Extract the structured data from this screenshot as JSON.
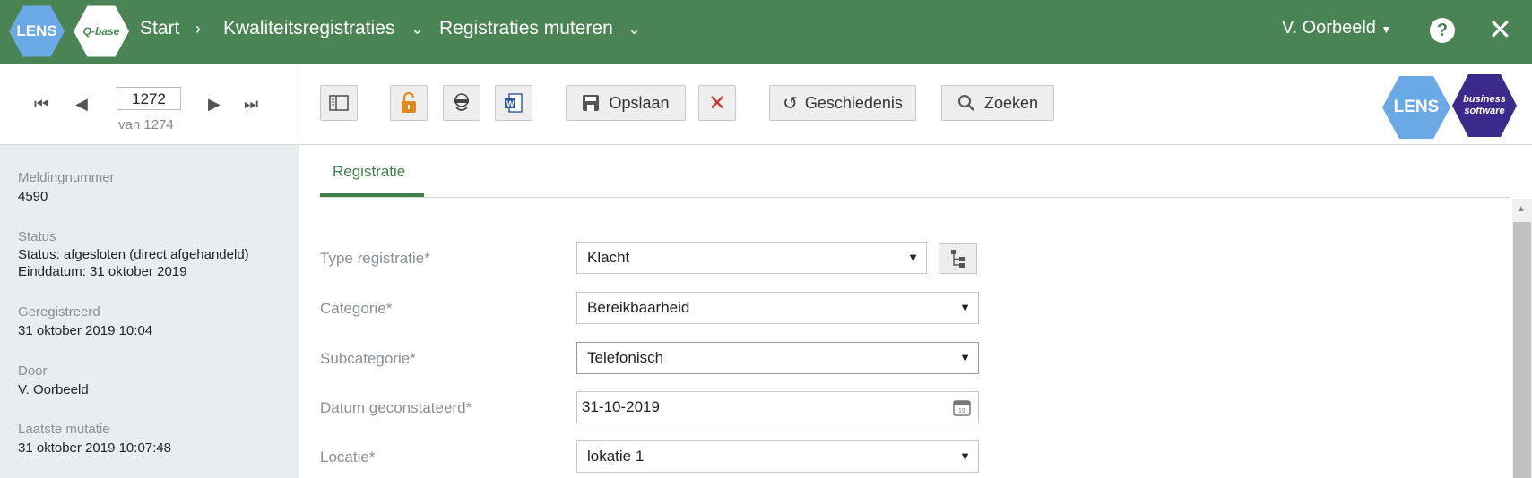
{
  "header": {
    "logo_lens": "LENS",
    "logo_qbase": "Q-base",
    "breadcrumb": [
      "Start",
      "Kwaliteitsregistraties",
      "Registraties muteren"
    ],
    "user": "V. Oorbeeld",
    "help": "?",
    "close": "✕",
    "bg_color": "#4a8454"
  },
  "nav": {
    "record_number": "1272",
    "record_of": "van 1274"
  },
  "toolbar": {
    "save_label": "Opslaan",
    "history_label": "Geschiedenis",
    "search_label": "Zoeken",
    "brand_lens": "LENS",
    "brand_business": "business software"
  },
  "sidebar": {
    "items": [
      {
        "label": "Meldingnummer",
        "value": "4590"
      },
      {
        "label": "Status",
        "value": "Status: afgesloten (direct afgehandeld)",
        "value2": "Einddatum: 31 oktober 2019"
      },
      {
        "label": "Geregistreerd",
        "value": "31 oktober 2019 10:04"
      },
      {
        "label": "Door",
        "value": "V. Oorbeeld"
      },
      {
        "label": "Laatste mutatie",
        "value": "31 oktober 2019 10:07:48"
      }
    ]
  },
  "main": {
    "tab": "Registratie",
    "fields": [
      {
        "label": "Type registratie*",
        "value": "Klacht"
      },
      {
        "label": "Categorie*",
        "value": "Bereikbaarheid"
      },
      {
        "label": "Subcategorie*",
        "value": "Telefonisch"
      },
      {
        "label": "Datum geconstateerd*",
        "value": "31-10-2019"
      },
      {
        "label": "Locatie*",
        "value": "lokatie 1"
      }
    ]
  }
}
